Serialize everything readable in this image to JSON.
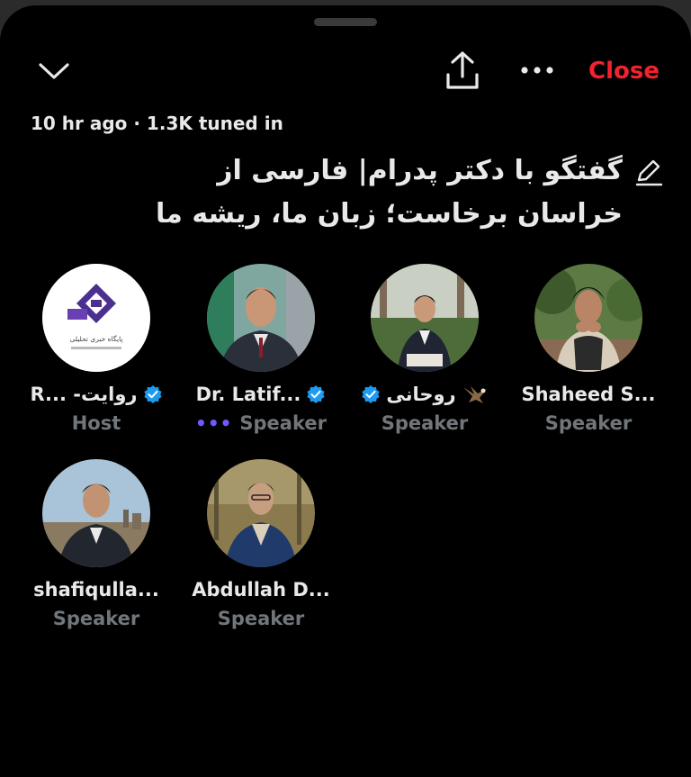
{
  "header": {
    "close_label": "Close",
    "icons": {
      "collapse": "chevron-down-icon",
      "share": "share-icon",
      "more": "more-icon",
      "edit": "pencil-icon"
    },
    "accent_color": "#f4212e"
  },
  "space": {
    "meta": "10 hr ago · 1.3K tuned in",
    "title": "گفتگو با دکتر پدرام| فارسی از خراسان برخاست؛ زبان ما، ریشه ما"
  },
  "participants": [
    {
      "name": "R... -روایت",
      "role": "Host",
      "verified": true,
      "avatar_text": "پایگاه خبری تحلیلی"
    },
    {
      "name": "Dr. Latif...",
      "role": "Speaker",
      "verified": true,
      "speaking": true
    },
    {
      "name": "روحانی",
      "role": "Speaker",
      "verified": true
    },
    {
      "name": "Shaheed S...",
      "role": "Speaker",
      "verified": false
    },
    {
      "name": "shafiqulla...",
      "role": "Speaker",
      "verified": false
    },
    {
      "name": "Abdullah D...",
      "role": "Speaker",
      "verified": false
    }
  ],
  "colors": {
    "background": "#000000",
    "primary_text": "#e7e9ea",
    "secondary_text": "#71767b",
    "verified_blue": "#1d9bf0",
    "speaking_purple": "#7856ff"
  }
}
